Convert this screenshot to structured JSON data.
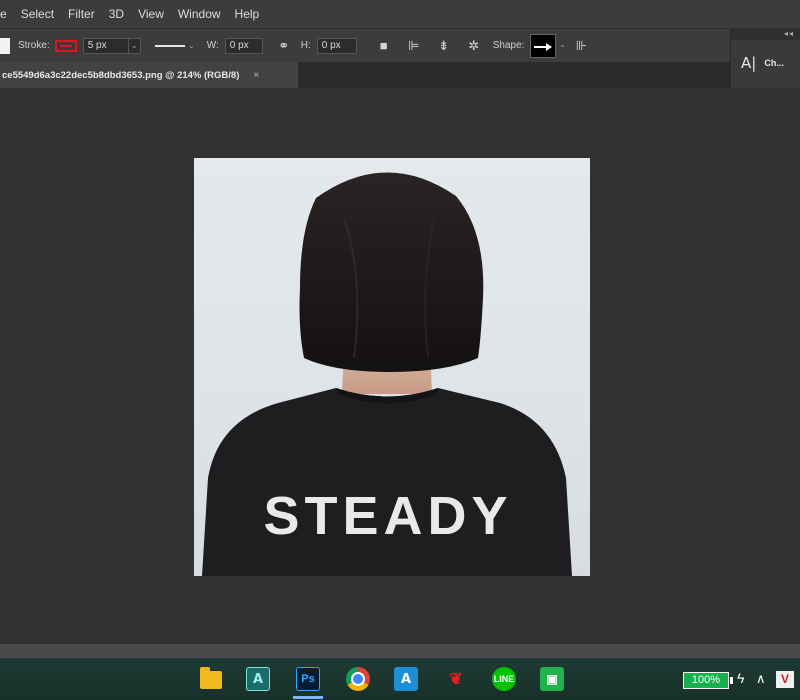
{
  "menu": {
    "items": [
      "e",
      "Select",
      "Filter",
      "3D",
      "View",
      "Window",
      "Help"
    ]
  },
  "options": {
    "stroke_label": "Stroke:",
    "stroke_color": "#e0141e",
    "stroke_width": "5 px",
    "w_label": "W:",
    "w_value": "0 px",
    "h_label": "H:",
    "h_value": "0 px",
    "shape_label": "Shape:"
  },
  "document": {
    "tab_title": "ce5549d6a3c22dec5b8dbd3653.png @ 214% (RGB/8)",
    "close": "×"
  },
  "panel": {
    "collapse": "◂◂",
    "label": "Ch..."
  },
  "photo": {
    "shirt_text": "STEADY"
  },
  "taskbar": {
    "battery": "100%",
    "apps": [
      "file-explorer",
      "app-a",
      "photoshop",
      "chrome",
      "app-a-blue",
      "app-red",
      "line",
      "app-green"
    ],
    "ps_label": "Ps",
    "a_label": "A",
    "line_label": "LINE",
    "v_label": "V"
  }
}
